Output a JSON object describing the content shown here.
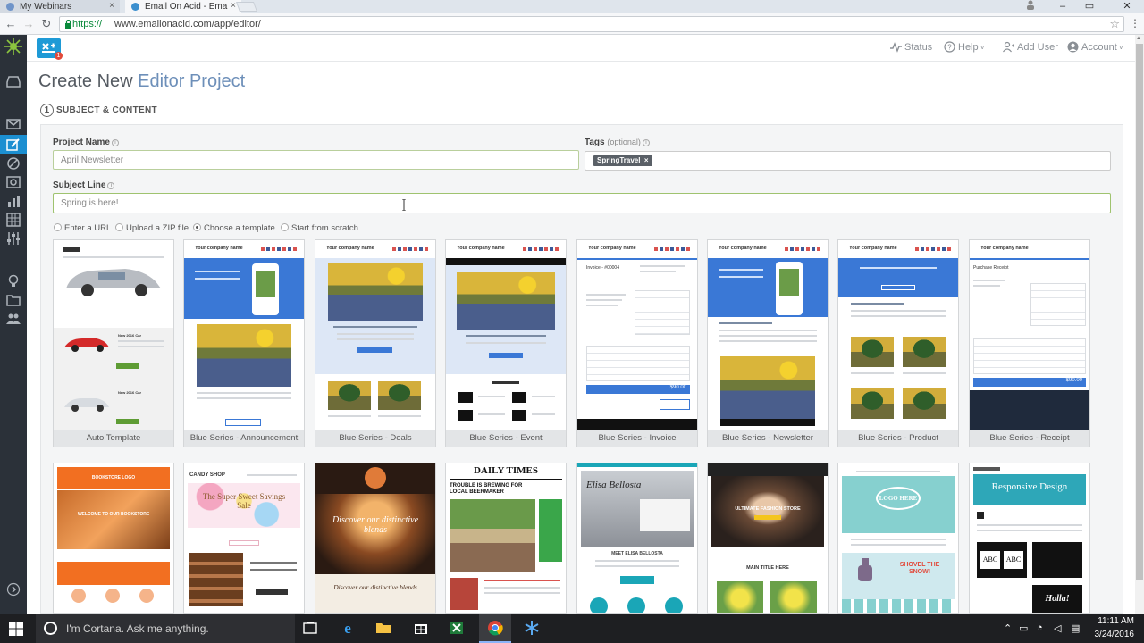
{
  "browser": {
    "tabs": [
      {
        "title": "My Webinars",
        "close": "×"
      },
      {
        "title": "Email On Acid - Ema",
        "close": "×"
      }
    ],
    "url_scheme": "https://",
    "url_rest": "www.emailonacid.com/app/editor/",
    "window_controls": [
      "–",
      "▭",
      "✕"
    ]
  },
  "header": {
    "logo_badge": "1",
    "status": "Status",
    "help": "Help",
    "add_user": "Add User",
    "account": "Account"
  },
  "page": {
    "title_plain": "Create New ",
    "title_accent": "Editor Project",
    "step_number": "1",
    "step_label": "SUBJECT & CONTENT"
  },
  "form": {
    "project_name_label": "Project Name",
    "project_name_value": "April Newsletter",
    "tags_label": "Tags",
    "tags_optional": "(optional)",
    "tag_chip": "SpringTravel",
    "tag_chip_remove": "×",
    "subject_label": "Subject Line",
    "subject_value": "Spring is here!",
    "source_options": [
      {
        "label": "Enter a URL",
        "selected": false
      },
      {
        "label": "Upload a ZIP file",
        "selected": false
      },
      {
        "label": "Choose a template",
        "selected": true
      },
      {
        "label": "Start from scratch",
        "selected": false
      }
    ]
  },
  "templates_row1": [
    "Auto Template",
    "Blue Series - Announcement",
    "Blue Series - Deals",
    "Blue Series - Event",
    "Blue Series - Invoice",
    "Blue Series - Newsletter",
    "Blue Series - Product",
    "Blue Series - Receipt"
  ],
  "thumb_text": {
    "company": "Your company name",
    "bookstore": "BOOKSTORE LOGO",
    "welcome": "WELCOME TO OUR BOOKSTORE",
    "candy": "CANDY SHOP",
    "sweet": "The Super Sweet Savings Sale",
    "coffee": "Discover our distinctive blends",
    "daily": "DAILY TIMES",
    "trouble": "TROUBLE IS BREWING FOR LOCAL BEERMAKER",
    "elisa": "MEET ELISA BELLOSTA",
    "fashion": "ULTIMATE FASHION STORE",
    "main_title": "MAIN TITLE HERE",
    "logo_here": "LOGO HERE",
    "shovel": "SHOVEL THE SNOW!",
    "responsive": "Responsive Design",
    "abc": "ABC",
    "hola": "Holla!",
    "invoice": "Invoice - #00004",
    "receipt": "Purchase Receipt",
    "total": "$90.00"
  },
  "taskbar": {
    "cortana": "I'm Cortana. Ask me anything.",
    "time": "11:11 AM",
    "date": "3/24/2016"
  },
  "colors": {
    "accent": "#6d8fb9",
    "sidebar": "#2b3139",
    "active": "#1c8fd1",
    "blue_series": "#3a78d6"
  }
}
